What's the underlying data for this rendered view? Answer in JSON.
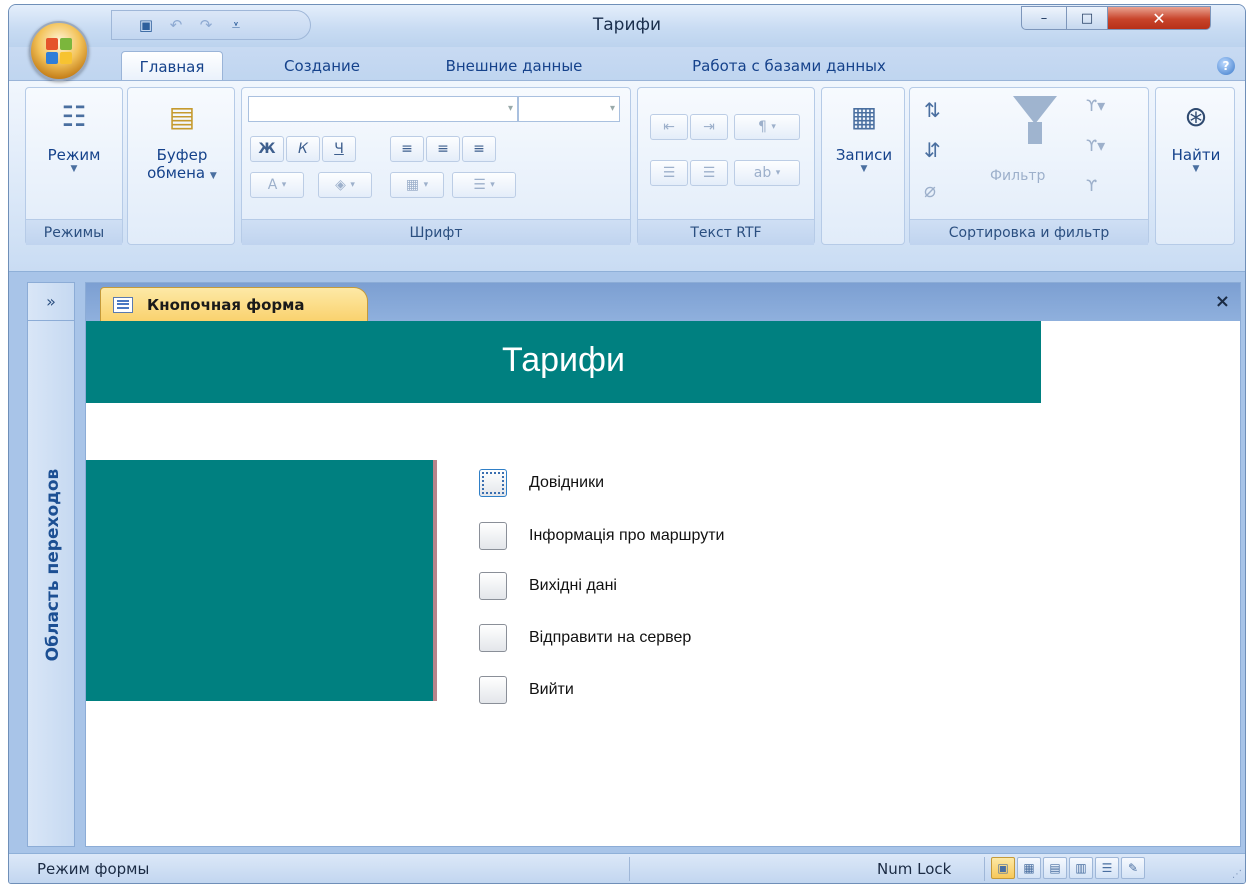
{
  "window": {
    "title": "Тарифи",
    "controls": {
      "minimize": "–",
      "maximize": "□",
      "close": "✕"
    }
  },
  "quick_access": {
    "items": [
      "save-icon",
      "undo-icon",
      "redo-icon",
      "customize-icon"
    ]
  },
  "ribbon": {
    "tabs": [
      {
        "label": "Главная",
        "active": true
      },
      {
        "label": "Создание",
        "active": false
      },
      {
        "label": "Внешние данные",
        "active": false
      },
      {
        "label": "Работа с базами данных",
        "active": false
      }
    ],
    "groups": {
      "views": {
        "label": "Режимы",
        "button": "Режим"
      },
      "clipboard": {
        "button_line1": "Буфер",
        "button_line2": "обмена"
      },
      "font": {
        "label": "Шрифт",
        "bold": "Ж",
        "italic": "К",
        "underline": "Ч",
        "font_color": "A"
      },
      "rich_text": {
        "label": "Текст RTF"
      },
      "records": {
        "button": "Записи"
      },
      "sort_filter": {
        "label": "Сортировка и фильтр",
        "filter": "Фильтр"
      },
      "find": {
        "button": "Найти"
      }
    }
  },
  "navigation_pane": {
    "toggle": "»",
    "label": "Область переходов"
  },
  "document": {
    "tab_label": "Кнопочная форма",
    "close": "×",
    "form_title": "Тарифи",
    "menu_items": [
      {
        "label": "Довідники",
        "focused": true
      },
      {
        "label": "Інформація про маршрути",
        "focused": false
      },
      {
        "label": "Вихідні дані",
        "focused": false
      },
      {
        "label": "Відправити на сервер",
        "focused": false
      },
      {
        "label": "Вийти",
        "focused": false
      }
    ],
    "accent_color": "#008080"
  },
  "status_bar": {
    "mode": "Режим формы",
    "num_lock": "Num Lock",
    "view_buttons": [
      "form-view-icon",
      "datasheet-view-icon",
      "pivot-table-icon",
      "pivot-chart-icon",
      "layout-view-icon",
      "design-view-icon"
    ]
  }
}
